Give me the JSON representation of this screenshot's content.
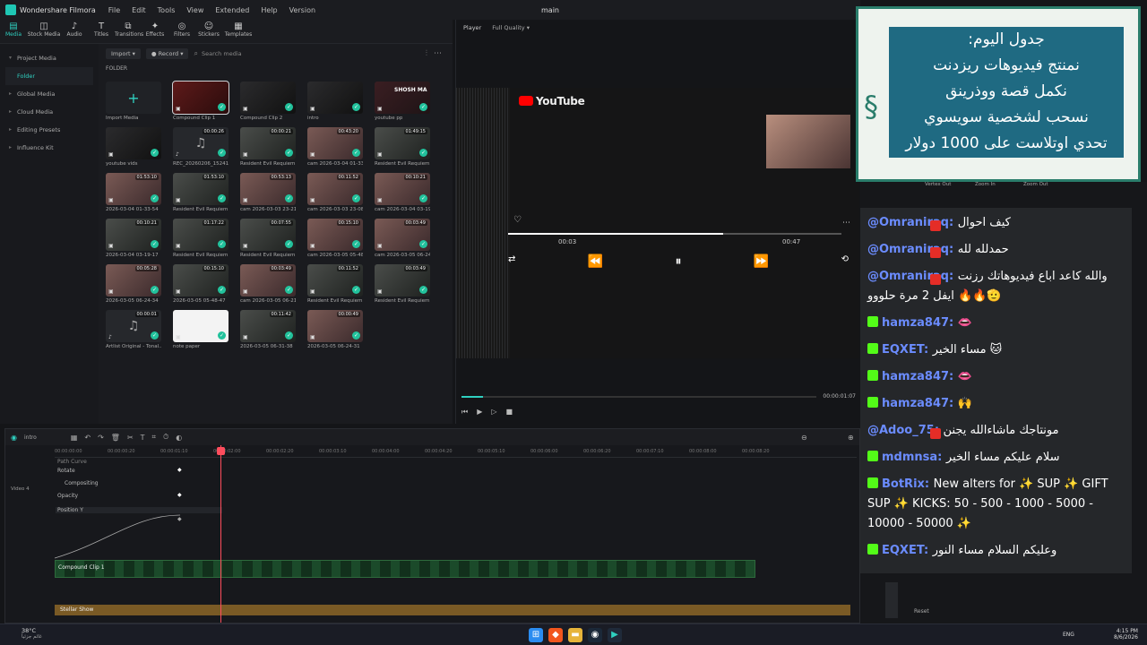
{
  "app": {
    "name": "Wondershare Filmora",
    "menu": [
      "File",
      "Edit",
      "Tools",
      "View",
      "Extended",
      "Help",
      "Version"
    ],
    "window_title": "main"
  },
  "toolbar": [
    {
      "label": "Media",
      "icon": "media-icon"
    },
    {
      "label": "Stock Media",
      "icon": "stock-media-icon"
    },
    {
      "label": "Audio",
      "icon": "audio-icon"
    },
    {
      "label": "Titles",
      "icon": "titles-icon"
    },
    {
      "label": "Transitions",
      "icon": "transitions-icon"
    },
    {
      "label": "Effects",
      "icon": "effects-icon"
    },
    {
      "label": "Filters",
      "icon": "filters-icon"
    },
    {
      "label": "Stickers",
      "icon": "stickers-icon"
    },
    {
      "label": "Templates",
      "icon": "templates-icon"
    }
  ],
  "sidebar": {
    "items": [
      {
        "label": "Project Media"
      },
      {
        "label": "Folder"
      },
      {
        "label": "Global Media"
      },
      {
        "label": "Cloud Media"
      },
      {
        "label": "Editing Presets"
      },
      {
        "label": "Influence Kit"
      }
    ]
  },
  "media": {
    "import_label": "Import",
    "record_label": "Record",
    "search_placeholder": "Search media",
    "folder_label": "FOLDER",
    "items": [
      {
        "name": "Import Media",
        "type": "add"
      },
      {
        "name": "Compound Clip 1",
        "type": "red",
        "selected": true
      },
      {
        "name": "Compound Clip 2",
        "type": "dark"
      },
      {
        "name": "intro",
        "type": "dark"
      },
      {
        "name": "youtube pp",
        "type": "shosh",
        "thumb_text": "SHOSH MA"
      },
      {
        "name": "youtube vids",
        "type": "dark"
      },
      {
        "name": "REC_20260206_152418",
        "type": "audio",
        "duration": "00:00:26"
      },
      {
        "name": "Resident Evil Requiem...",
        "type": "game",
        "duration": "00:00:21"
      },
      {
        "name": "cam 2026-03-04 01-33...",
        "type": "girl",
        "duration": "00:43:20"
      },
      {
        "name": "Resident Evil Requiem...",
        "type": "game",
        "duration": "01:49:15"
      },
      {
        "name": "2026-03-04 01-33-54",
        "type": "girl",
        "duration": "01:53:10"
      },
      {
        "name": "Resident Evil Requiem...",
        "type": "game",
        "duration": "01:53:10"
      },
      {
        "name": "cam 2026-03-03 23-21...",
        "type": "girl",
        "duration": "00:53:13"
      },
      {
        "name": "cam 2026-03-03 23-08...",
        "type": "girl",
        "duration": "00:11:52"
      },
      {
        "name": "cam 2026-03-04 03-19...",
        "type": "girl",
        "duration": "00:10:21"
      },
      {
        "name": "2026-03-04 03-19-17",
        "type": "game",
        "duration": "00:10:21"
      },
      {
        "name": "Resident Evil Requiem...",
        "type": "game",
        "duration": "01:17:22"
      },
      {
        "name": "Resident Evil Requiem...",
        "type": "game",
        "duration": "00:07:55"
      },
      {
        "name": "cam 2026-03-05 05-48...",
        "type": "girl",
        "duration": "00:15:10"
      },
      {
        "name": "cam 2026-03-05 06-24...",
        "type": "girl",
        "duration": "00:03:49"
      },
      {
        "name": "2026-03-05 06-24-34",
        "type": "girl",
        "duration": "00:05:28"
      },
      {
        "name": "2026-03-05 05-48-47",
        "type": "game",
        "duration": "00:15:10"
      },
      {
        "name": "cam 2026-03-05 06-21...",
        "type": "girl",
        "duration": "00:03:49"
      },
      {
        "name": "Resident Evil Requiem...",
        "type": "game",
        "duration": "00:11:52"
      },
      {
        "name": "Resident Evil Requiem...",
        "type": "game",
        "duration": "00:03:49"
      },
      {
        "name": "Artlist Original - Tonal...",
        "type": "audio",
        "duration": "00:00:01"
      },
      {
        "name": "note paper",
        "type": "white"
      },
      {
        "name": "2026-03-05 06-31-38",
        "type": "game",
        "duration": "00:11:42"
      },
      {
        "name": "2026-03-05 06-24-31",
        "type": "girl",
        "duration": "00:00:49"
      }
    ]
  },
  "player": {
    "label": "Player",
    "quality": "Full Quality",
    "yt_brand": "YouTube",
    "yt_time_current": "00:03",
    "yt_time_total": "00:47",
    "timecode": "00:00:01:07"
  },
  "timeline": {
    "sequence": "intro",
    "ruler": [
      "00:00:00:00",
      "00:00:00:20",
      "00:00:01:10",
      "00:00:02:00",
      "00:00:02:20",
      "00:00:03:10",
      "00:00:04:00",
      "00:00:04:20",
      "00:00:05:10",
      "00:00:06:00",
      "00:00:06:20",
      "00:00:07:10",
      "00:00:08:00",
      "00:00:08:20"
    ],
    "keyframes": [
      "Path Curve",
      "Rotate",
      "Compositing",
      "Opacity",
      "Position Y"
    ],
    "video_track": "Video 4",
    "clip": "Compound Clip 1",
    "audio_clip": "Stellar Show"
  },
  "overlay": {
    "lines": [
      "جدول اليوم:",
      "نمنتج فيديوهات ريزدنت",
      "نكمل قصة ووذرينق",
      "نسحب لشخصية سويسوي",
      "تحدي اوتلاست على 1000 دولار"
    ]
  },
  "right_panel_labels": [
    "Vertex Out",
    "Zoom In",
    "Zoom Out"
  ],
  "chat": [
    {
      "platform": "youtube",
      "user": "@Omraniraq",
      "text": "كيف احوال"
    },
    {
      "platform": "youtube",
      "user": "@Omraniraq",
      "text": "حمدلله لله"
    },
    {
      "platform": "youtube",
      "user": "@Omraniraq",
      "text": "والله كاعد اباع فيديوهاتك رزنت ايفل 2 مرة حلووو 🔥🔥🫡"
    },
    {
      "platform": "kick",
      "user": "hamza847",
      "text": "👄"
    },
    {
      "platform": "kick",
      "user": "EQXET",
      "text": "مساء الخير 🐱"
    },
    {
      "platform": "kick",
      "user": "hamza847",
      "text": "👄"
    },
    {
      "platform": "kick",
      "user": "hamza847",
      "text": "🙌"
    },
    {
      "platform": "youtube",
      "user": "@Adoo_75",
      "text": "مونتاجك ماشاءالله يجنن"
    },
    {
      "platform": "kick",
      "user": "mdmnsa",
      "text": "سلام عليكم مساء الخير"
    },
    {
      "platform": "kick",
      "user": "BotRix",
      "text": "New alters for ✨ SUP ✨ GIFT SUP ✨ KICKS: 50 - 500 - 1000 - 5000 - 10000 - 50000 ✨"
    },
    {
      "platform": "kick",
      "user": "EQXET",
      "text": "وعليكم السلام مساء النور"
    }
  ],
  "reset_label": "Reset",
  "taskbar": {
    "weather_temp": "38°C",
    "weather_desc": "غائم جزئياً",
    "lang": "ENG",
    "time": "4:15 PM",
    "date": "8/6/2026"
  },
  "colors": {
    "accent": "#2fd0c0",
    "kick": "#53fc18",
    "youtube": "#e52d27",
    "username": "#6b8cff"
  }
}
